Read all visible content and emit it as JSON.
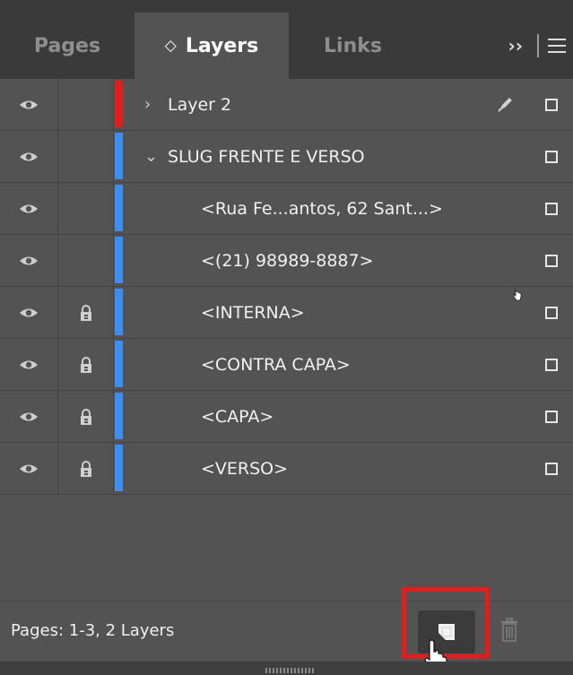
{
  "tabs": {
    "pages": "Pages",
    "layers": "Layers",
    "links": "Links",
    "layers_icon": "up-down-arrows-icon",
    "more_icon": "double-chevron-icon",
    "menu_icon": "hamburger-menu-icon"
  },
  "colors": {
    "panel_bg": "#535353",
    "tabbar_bg": "#3a3a3a",
    "layer2_color": "#e21d1d",
    "slug_color": "#3d8ef0",
    "highlight_border": "#e21d1d"
  },
  "layers": [
    {
      "name": "Layer 2",
      "twisty": "›",
      "lock_visible": false,
      "color": "#e21d1d",
      "has_pen": true
    },
    {
      "name": "SLUG FRENTE E VERSO",
      "twisty": "⌄",
      "lock_visible": false,
      "color": "#3d8ef0",
      "has_pen": false
    },
    {
      "name": "<Rua Fe...antos, 62 Sant...>",
      "twisty": "",
      "lock_visible": false,
      "color": "#3d8ef0",
      "has_pen": false
    },
    {
      "name": "<(21) 98989-8887>",
      "twisty": "",
      "lock_visible": false,
      "color": "#3d8ef0",
      "has_pen": false
    },
    {
      "name": "<INTERNA>",
      "twisty": "",
      "lock_visible": true,
      "color": "#3d8ef0",
      "has_pen": false
    },
    {
      "name": "<CONTRA CAPA>",
      "twisty": "",
      "lock_visible": true,
      "color": "#3d8ef0",
      "has_pen": false
    },
    {
      "name": "<CAPA>",
      "twisty": "",
      "lock_visible": true,
      "color": "#3d8ef0",
      "has_pen": false
    },
    {
      "name": "<VERSO>",
      "twisty": "",
      "lock_visible": true,
      "color": "#3d8ef0",
      "has_pen": false
    }
  ],
  "status": {
    "text": "Pages: 1-3, 2 Layers"
  },
  "footer": {
    "new_layer_icon": "new-layer-icon",
    "trash_icon": "trash-icon"
  }
}
